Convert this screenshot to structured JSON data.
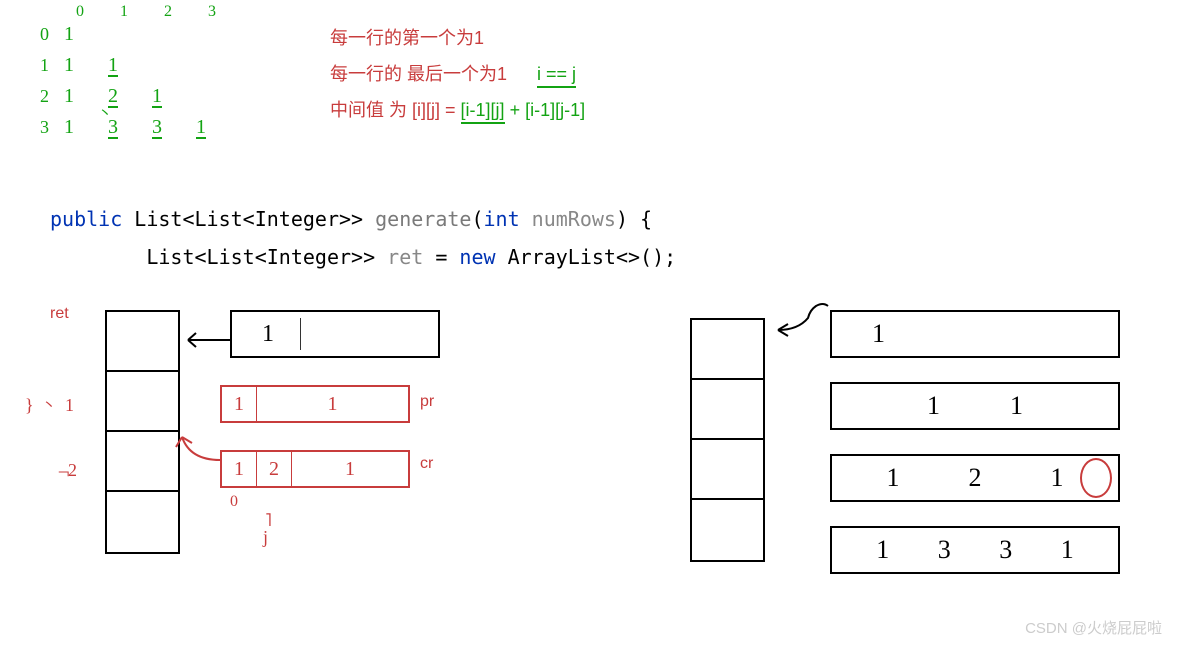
{
  "triangle": {
    "col_headers": [
      "0",
      "1",
      "2",
      "3"
    ],
    "rows": [
      {
        "idx": "0",
        "cells": [
          "1"
        ]
      },
      {
        "idx": "1",
        "cells": [
          "1",
          "1"
        ]
      },
      {
        "idx": "2",
        "cells": [
          "1",
          "2",
          "1"
        ]
      },
      {
        "idx": "3",
        "cells": [
          "1",
          "3",
          "3",
          "1"
        ]
      }
    ]
  },
  "rules": {
    "line1": "每一行的第一个为1",
    "line2_a": "每一行的 最后一个为1",
    "line2_b": "i == j",
    "line3_a": "中间值 为  [i][j]  = ",
    "line3_b": "[i-1][j]",
    "line3_c": " + [i-1][j-1]"
  },
  "code": {
    "l1": {
      "public": "public",
      "type1": "List<List<Integer>>",
      "method": "generate",
      "paren_open": "(",
      "int": "int",
      "param": "numRows",
      "rest": ") {"
    },
    "l2": {
      "indent": "        ",
      "type": "List<List<Integer>>",
      "var": "ret",
      "eq": " = ",
      "new": "new",
      "ctor": " ArrayList<>();"
    }
  },
  "diag_left": {
    "ret": "ret",
    "box1": "1",
    "box_pr": [
      "1",
      "1"
    ],
    "pr_label": "pr",
    "box_cr": [
      "1",
      "2",
      "1"
    ],
    "cr_label": "cr",
    "side_labels": {
      "brace": "}",
      "one": "1",
      "two": "2"
    },
    "marks": {
      "zero": "0",
      "j": "j"
    }
  },
  "diag_right": {
    "rows": [
      [
        "1"
      ],
      [
        "1",
        "1"
      ],
      [
        "1",
        "2",
        "1"
      ],
      [
        "1",
        "3",
        "3",
        "1"
      ]
    ]
  },
  "watermark": "CSDN @火烧屁屁啦"
}
